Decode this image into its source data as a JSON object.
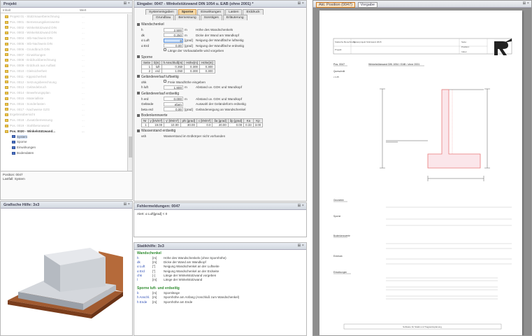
{
  "project_panel": {
    "title": "Projekt",
    "ctrl": "⊞ ×",
    "col_name": "Inhalt",
    "col_size": "Wert",
    "items": [
      {
        "label": "Projekt 01 - Stützmauerberechnung",
        "size": "..."
      },
      {
        "label": "Pos. 0001 - Bemessungskennwerte",
        "size": "..."
      },
      {
        "label": "Pos. 0002 - Winkelstützwand DIN",
        "size": "..."
      },
      {
        "label": "Pos. 0003 - Winkelstützwand DIN",
        "size": "..."
      },
      {
        "label": "Pos. 0004 - Stb-Nachweis DIN",
        "size": "..."
      },
      {
        "label": "Pos. 0005 - Stb-Nachweis DIN",
        "size": "..."
      },
      {
        "label": "Pos. 0006 - Grundbruch DIN",
        "size": "..."
      },
      {
        "label": "Pos. 0007 - Einwirkungen",
        "size": "..."
      },
      {
        "label": "Pos. 0008 - Erddruckberechnung",
        "size": "..."
      },
      {
        "label": "Pos. 0009 - Erddruck aus Auflast",
        "size": "..."
      },
      {
        "label": "Pos. 0010 - Gleitsicherheit",
        "size": "..."
      },
      {
        "label": "Pos. 0011 - Kippsicherheit",
        "size": "..."
      },
      {
        "label": "Pos. 0012 - Setzungsberechnung",
        "size": "..."
      },
      {
        "label": "Pos. 0013 - Geländebruch",
        "size": "..."
      },
      {
        "label": "Pos. 0014 - Bewehrungsplan",
        "size": "..."
      },
      {
        "label": "Pos. 0015 - Materialliste",
        "size": "..."
      },
      {
        "label": "Pos. 0016 - Sonderlasten",
        "size": "..."
      },
      {
        "label": "Pos. 0017 - Nachweise GZG",
        "size": "..."
      },
      {
        "label": "Ergebnisübersicht",
        "size": "..."
      },
      {
        "label": "Pos. 0018 - Zusatzbemessung",
        "size": "..."
      },
      {
        "label": "Pos. 0019 - Stahlbetonwand",
        "size": "..."
      },
      {
        "label": "Pos. 0020 - Winkelstützwand...",
        "size": "..."
      }
    ],
    "subitems": [
      "System",
      "Sporne",
      "Einwirkungen",
      "Bodendaten"
    ],
    "selected_subitem": "System",
    "status_line1": "Position: 0047",
    "status_line2": "Lastfall: System"
  },
  "graphic_panel": {
    "title": "Grafische Hilfe: 3x3",
    "ctrl": "⊞ ×"
  },
  "input_panel": {
    "title": "Eingabe: 0047 - Winkelstützwand DIN 1054 u. EAB (ohne 2001) *",
    "ctrl": "⊞ ×",
    "tabs_row1": [
      "Systemeingaben",
      "Sporne",
      "Einwirkungen",
      "Lasten",
      "Erddruck"
    ],
    "tabs_row2": [
      "Grundbau",
      "Bemessung",
      "Sonstiges",
      "Erläuterung"
    ],
    "active_tab": "Sporne",
    "sec_wall": "Wandschenkel",
    "wall_rows": [
      {
        "name": "h",
        "value": "2.500",
        "unit": "m",
        "desc": "Höhe des Wandschenkels"
      },
      {
        "name": "dk",
        "value": "0.250",
        "unit": "m",
        "desc": "Dicke der Wand am Wandkopf"
      },
      {
        "name": "α Luft",
        "value": "0",
        "unit": "[grad]",
        "desc": "Neigung der Wandfläche luftseitig"
      },
      {
        "name": "α Erd",
        "value": "0.00",
        "unit": "[grad]",
        "desc": "Neigung der Wandfläche erdseitig"
      }
    ],
    "wall_check": "Länge der Vorbautabelle wird vorgeben",
    "sec_spur": "Sporne",
    "spur_headers": [
      "Seite",
      "b[m]",
      "h Anschluß[m]",
      "Höhe[m]",
      "Höhe[m]"
    ],
    "spur_rows": [
      [
        "1",
        "luft",
        "0.350",
        "0.300",
        "0.300"
      ],
      [
        "2",
        "erd",
        "1.050",
        "0.300",
        "0.300"
      ]
    ],
    "sec_air": "Geländeverlauf luftseitig",
    "air_check": "Freie Wandhöhe eingeben",
    "air_rows": [
      {
        "name": "h luft",
        "value": "1.800",
        "unit": "m",
        "desc": "Abstand uv. GOK und Wandkopf"
      }
    ],
    "sec_earth": "Geländeverlauf erdseitig",
    "earth_rows": [
      {
        "name": "h erd",
        "value": "0.000",
        "unit": "m",
        "desc": "Abstand uv. GOK und Wandkopf"
      },
      {
        "name": "Gelände",
        "value": "eben",
        "unit": "",
        "desc": "Auswahl der Geländeform erdseitig"
      },
      {
        "name": "beta erd",
        "value": "0.00",
        "unit": "[grad]",
        "desc": "Geländeneigung an Wandschenkel"
      }
    ],
    "sec_soil": "Bodenkennwerte",
    "soil_headers": [
      "Nr",
      "γ [kN/m³]",
      "γ' [kN/m³]",
      "phi [grad]",
      "c [kN/m²]",
      "δa [grad]",
      "δp [grad]",
      "Ka",
      "Kp"
    ],
    "soil_row": [
      "1",
      "19.00",
      "10.00",
      "30.00",
      "0.0",
      "20.00",
      "0.00",
      "0.33",
      "3.00"
    ],
    "sec_water": "Wasserstand erdseitig",
    "water_text": "Wasserstand im Erdkörper nicht vorhanden"
  },
  "errors_panel": {
    "title": "Fehlermeldungen: 0047",
    "ctrl": "⊞ ×",
    "message": "Alert: α Luft[grad] < 0"
  },
  "help_panel": {
    "title": "Statikhilfe: 3x3",
    "ctrl": "⊞ ×",
    "sec1": "Wandschenkel",
    "rows1": [
      {
        "sym": "h",
        "unit": "[m]",
        "text": "Höhe des Wandschenkels (ohne Spornhöhe)"
      },
      {
        "sym": "dk",
        "unit": "[m]",
        "text": "Dicke der Wand am Wandkopf"
      },
      {
        "sym": "α Luft",
        "unit": "[°]",
        "text": "Neigung Wandschenkel an der Luftseite"
      },
      {
        "sym": "α Erd",
        "unit": "[°]",
        "text": "Neigung Wandschenkel an der Erdseite"
      },
      {
        "sym": "chk",
        "unit": "[-]",
        "text": "Länge der Winkelstützwand vorgeben"
      },
      {
        "sym": "l",
        "unit": "[m]",
        "text": "Länge der Winkelstützwand"
      }
    ],
    "sec2": "Sporne luft- und erdseitig",
    "rows2": [
      {
        "sym": "b",
        "unit": "[m]",
        "text": "Spornlänge"
      },
      {
        "sym": "h Anschl.",
        "unit": "[m]",
        "text": "Spornhöhe am Anfang (Anschluß zum Wandschenkel)"
      },
      {
        "sym": "h Ende",
        "unit": "[m]",
        "text": "Spornhöhe am Ende"
      }
    ]
  },
  "preview_panel": {
    "title": "Ausdruck",
    "ctrl": "⊞ ×",
    "tabs": [
      "Akt. Position (0047)",
      "Vorgabe"
    ],
    "doc": {
      "header_left": [
        "Statische Berechnung",
        "Projekt:",
        "Datum:"
      ],
      "header_mid": "Musterprojekt Stützwand 2015",
      "header_right": [
        "Seite:",
        "Position:",
        "Index:"
      ],
      "pos_label": "Pos. 0047",
      "pos_title": "Winkelstützwand DIN 1054 / EAB / ohne 2001",
      "system_label": "Querschnitt",
      "section1": "Geometrie",
      "section2": "Sporne",
      "section3": "Bodenkennwerte",
      "section4": "Erddruck",
      "section5": "Einwirkungen",
      "footer": "Software für Statik und Tragwerksplanung"
    }
  },
  "colors": {
    "accent": "#e87a7a",
    "help_section": "#2e8b2e",
    "help_symbol": "#2f4fb5",
    "active_tab": "#f6d9a8"
  }
}
